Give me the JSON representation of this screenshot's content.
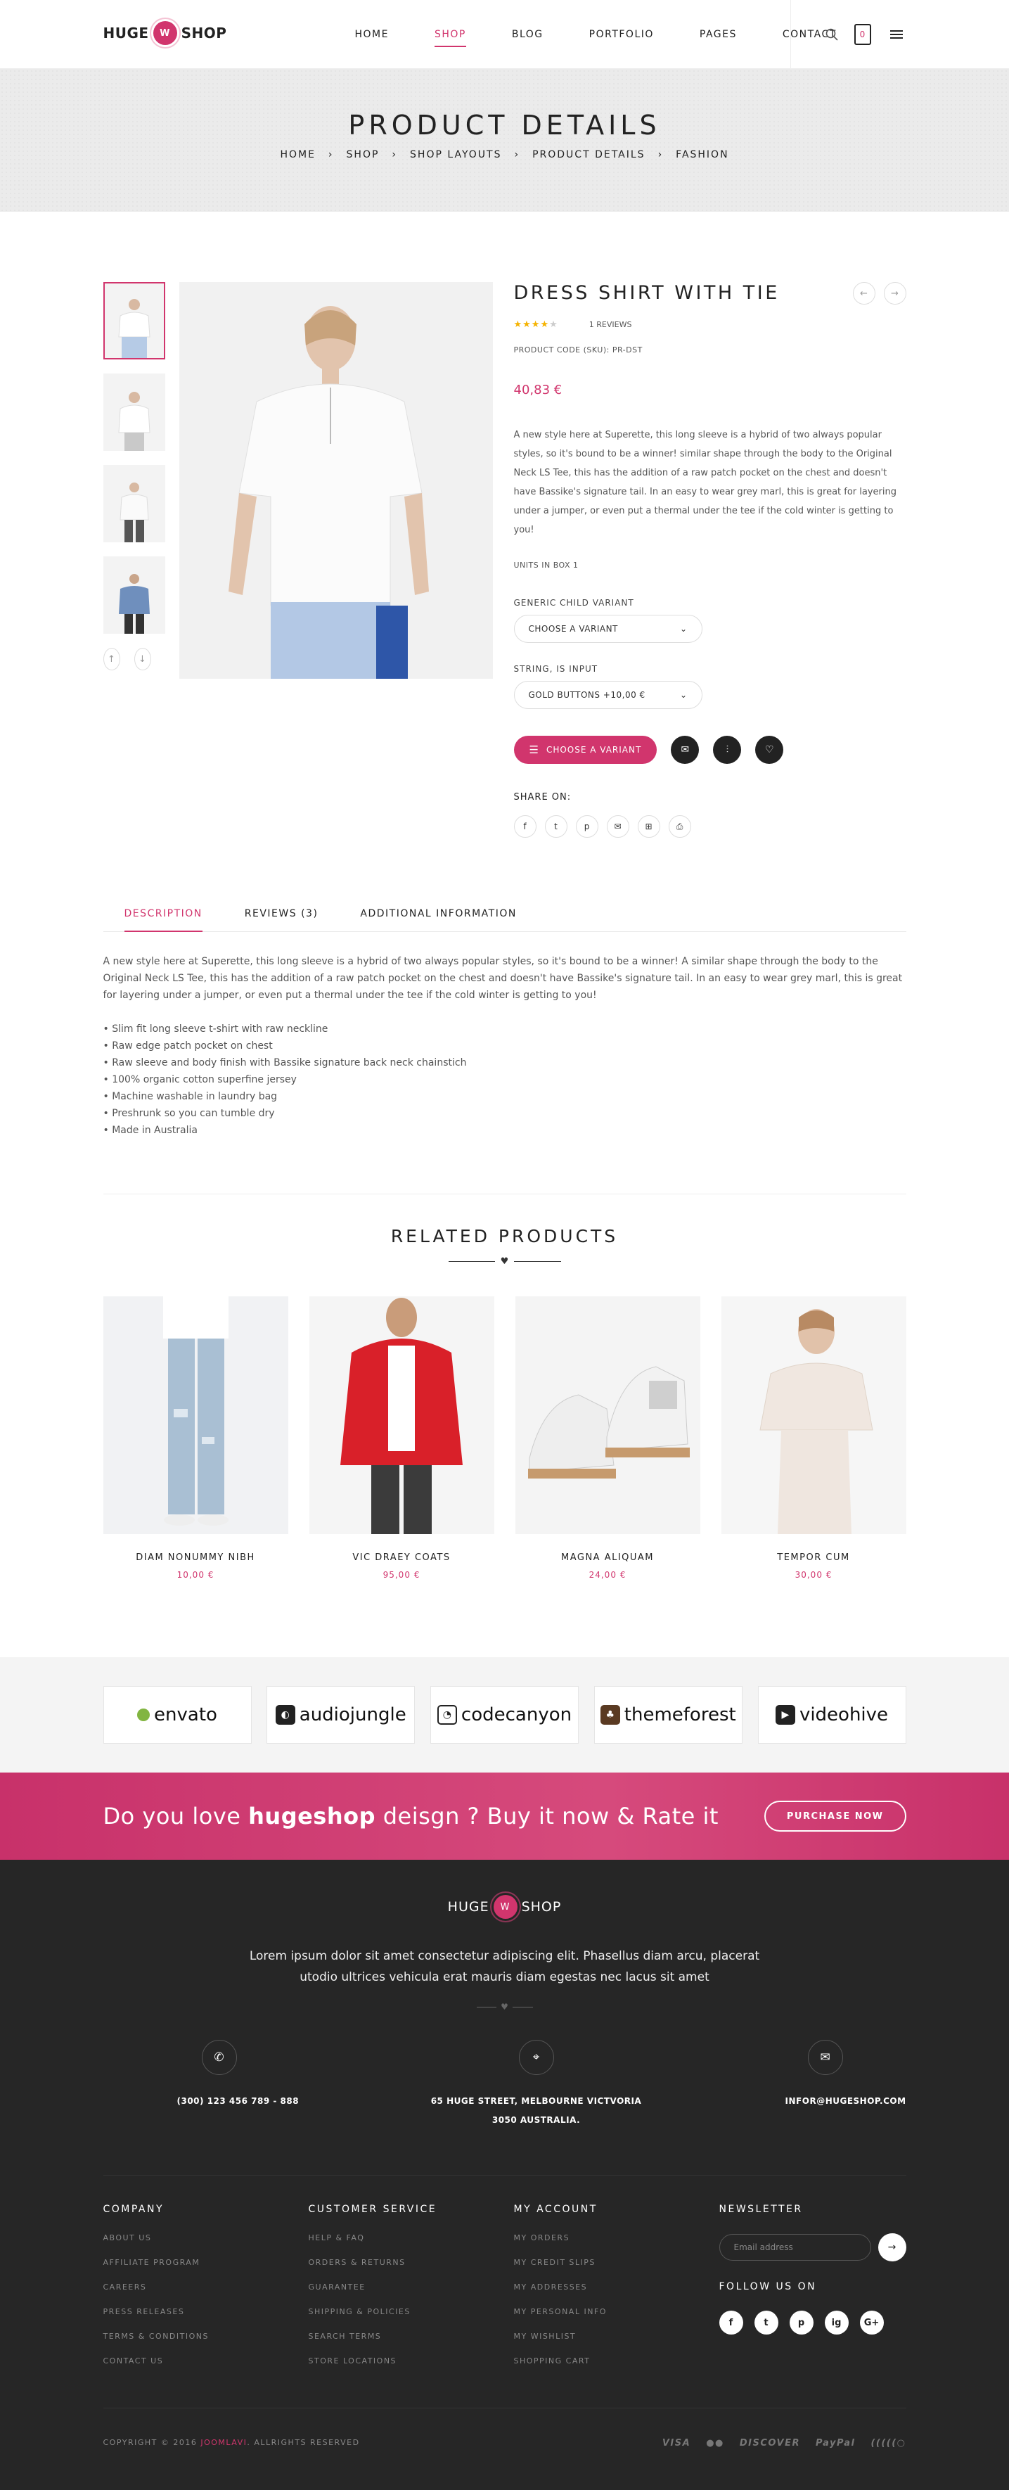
{
  "header": {
    "logo_left": "HUGE",
    "logo_badge": "W",
    "logo_right": "SHOP",
    "nav": [
      "HOME",
      "SHOP",
      "BLOG",
      "PORTFOLIO",
      "PAGES",
      "CONTACT"
    ],
    "active_nav": "SHOP",
    "cart_count": "0",
    "icons": [
      "search-icon",
      "cart-icon",
      "menu-icon"
    ]
  },
  "banner": {
    "title": "PRODUCT DETAILS",
    "breadcrumbs": [
      "HOME",
      "SHOP",
      "SHOP LAYOUTS",
      "PRODUCT DETAILS",
      "FASHION"
    ]
  },
  "product": {
    "name": "DRESS SHIRT WITH TIE",
    "rating": 4,
    "rating_max": 5,
    "reviews": "1 REVIEWS",
    "sku": "PRODUCT CODE (SKU): PR-DST",
    "price": "40,83 €",
    "description": "A new style here at Superette, this long sleeve is a hybrid of two always popular styles, so it's bound to be a winner! similar shape through the body to the Original Neck LS Tee, this has the addition of a raw patch pocket on the chest and doesn't have Bassike's signature tail. In an easy to wear grey marl, this is great for layering under a jumper, or even put a thermal under the tee if the cold winter is getting to you!",
    "units": "UNITS IN BOX 1",
    "variant_label": "GENERIC CHILD VARIANT",
    "variant_value": "CHOOSE A VARIANT",
    "string_label": "STRING, IS INPUT",
    "string_value": "GOLD BUTTONS +10,00 €",
    "cta": "CHOOSE A VARIANT",
    "share_label": "SHARE ON:"
  },
  "tabs": {
    "items": [
      "DESCRIPTION",
      "REVIEWS (3)",
      "ADDITIONAL INFORMATION"
    ],
    "active": "DESCRIPTION",
    "text": "A new style here at Superette, this long sleeve is a hybrid of two always popular styles, so it's bound to be a winner! A similar shape through the body to the Original Neck LS Tee, this has the addition of a raw patch pocket on the chest and doesn't have Bassike's signature tail. In an easy to wear grey marl, this is great for layering under a jumper, or even put a thermal under the tee if the cold winter is getting to you!",
    "bullets": [
      "Slim fit long sleeve t-shirt with raw neckline",
      "Raw edge patch pocket on chest",
      "Raw sleeve and body finish with Bassike signature back neck chainstich",
      "100% organic cotton superfine jersey",
      "Machine washable in laundry bag",
      "Preshrunk so you can tumble dry",
      "Made in Australia"
    ]
  },
  "related": {
    "title": "RELATED PRODUCTS",
    "items": [
      {
        "name": "DIAM NONUMMY NIBH",
        "price": "10,00 €"
      },
      {
        "name": "VIC DRAEY COATS",
        "price": "95,00 €"
      },
      {
        "name": "MAGNA ALIQUAM",
        "price": "24,00 €"
      },
      {
        "name": "TEMPOR CUM",
        "price": "30,00 €"
      }
    ]
  },
  "brands": [
    "envato",
    "audiojungle",
    "codecanyon",
    "themeforest",
    "videohive"
  ],
  "cta": {
    "text_pre": "Do you love ",
    "text_bold": "hugeshop",
    "text_post": " deisgn ? Buy it now & Rate it",
    "button": "PURCHASE NOW"
  },
  "footer": {
    "logo_left": "HUGE",
    "logo_badge": "W",
    "logo_right": "SHOP",
    "about": "Lorem ipsum dolor sit amet consectetur adipiscing elit. Phasellus diam arcu, placerat utodio ultrices vehicula erat mauris diam egestas nec lacus sit amet",
    "phone": "(300) 123 456 789 - 888",
    "address_line1": "65 HUGE STREET, MELBOURNE VICTVORIA",
    "address_line2": "3050 AUSTRALIA.",
    "email": "INFOR@HUGESHOP.COM",
    "columns": [
      {
        "title": "COMPANY",
        "links": [
          "ABOUT US",
          "AFFILIATE PROGRAM",
          "CAREERS",
          "PRESS RELEASES",
          "TERMS & CONDITIONS",
          "CONTACT US"
        ]
      },
      {
        "title": "CUSTOMER SERVICE",
        "links": [
          "HELP & FAQ",
          "ORDERS & RETURNS",
          "GUARANTEE",
          "SHIPPING & POLICIES",
          "SEARCH TERMS",
          "STORE LOCATIONS"
        ]
      },
      {
        "title": "MY ACCOUNT",
        "links": [
          "MY ORDERS",
          "MY CREDIT SLIPS",
          "MY ADDRESSES",
          "MY PERSONAL INFO",
          "MY WISHLIST",
          "SHOPPING CART"
        ]
      }
    ],
    "newsletter_title": "NEWSLETTER",
    "newsletter_placeholder": "Email address",
    "follow_title": "FOLLOW US ON",
    "socials": [
      "f",
      "t",
      "p",
      "ig",
      "G+"
    ],
    "copyright_pre": "COPYRIGHT © 2016 ",
    "copyright_brand": "JOOMLAVI",
    "copyright_post": ". ALLRIGHTS RESERVED",
    "payments": [
      "VISA",
      "●●",
      "DISCOVER",
      "PayPal",
      "(((((○"
    ]
  },
  "colors": {
    "accent": "#d1356d",
    "footer_bg": "#262626"
  }
}
